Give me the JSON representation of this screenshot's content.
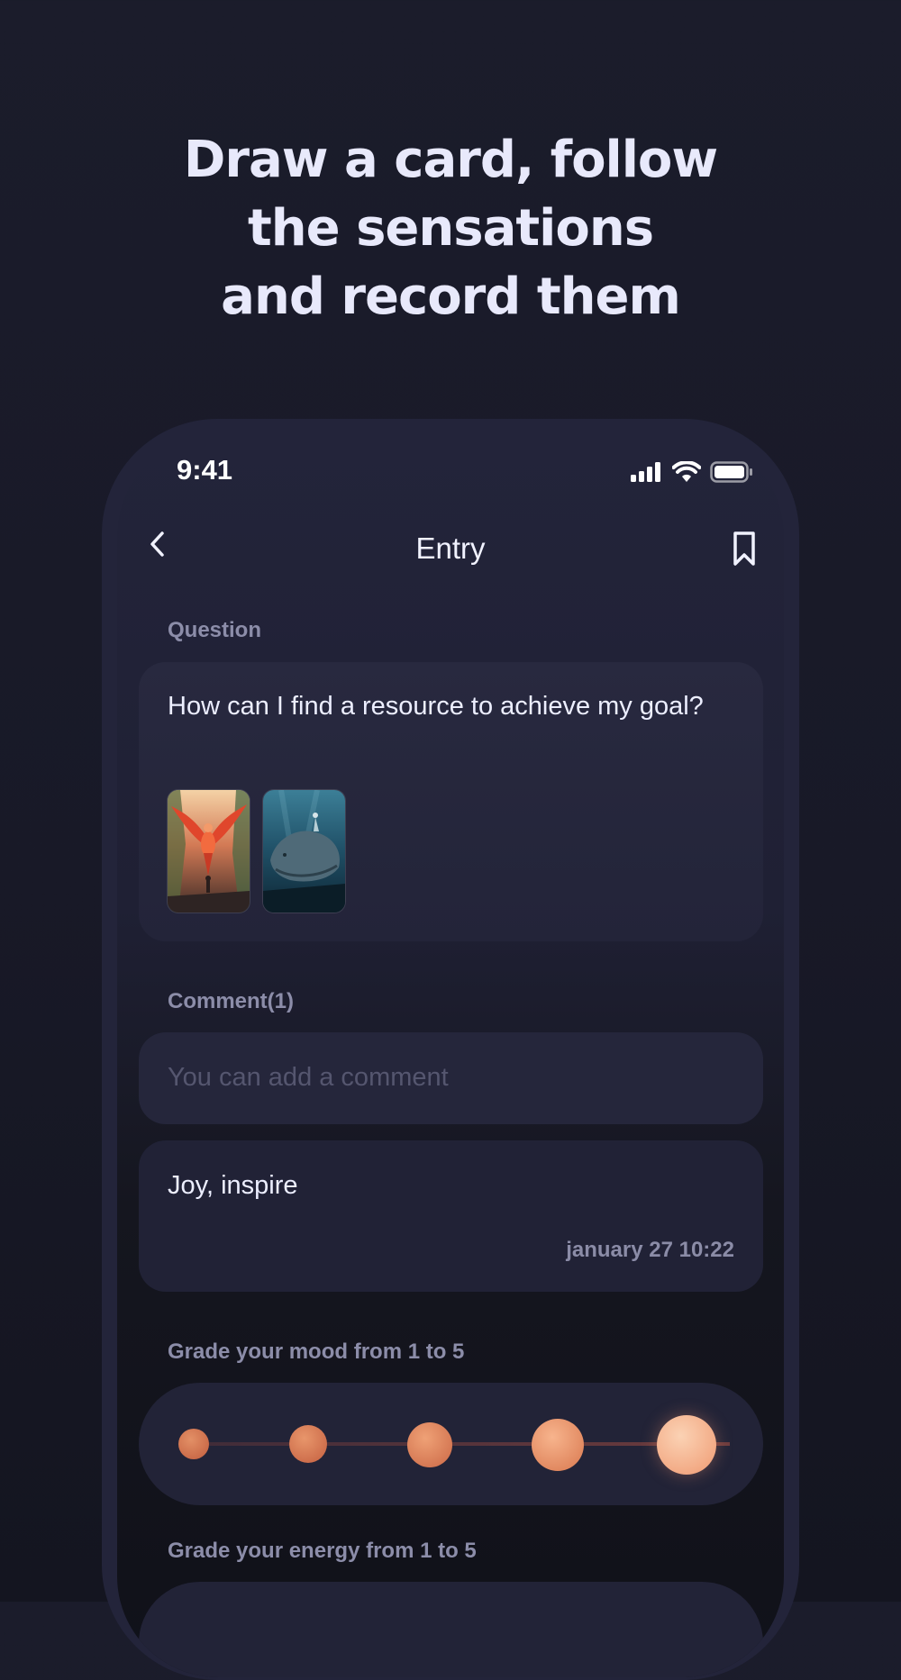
{
  "headline": {
    "line1": "Draw a card, follow",
    "line2": "the sensations",
    "line3": "and record them"
  },
  "status_bar": {
    "time": "9:41",
    "icons": [
      "signal-icon",
      "wifi-icon",
      "battery-icon"
    ]
  },
  "nav": {
    "title": "Entry",
    "back_icon": "chevron-left-icon",
    "bookmark_icon": "bookmark-icon"
  },
  "question": {
    "label": "Question",
    "text": "How can I find a resource to achieve my goal?",
    "cards": [
      "phoenix-card",
      "whale-card"
    ]
  },
  "comments": {
    "label": "Comment(1)",
    "input_placeholder": "You can add a comment",
    "items": [
      {
        "text": "Joy, inspire",
        "date": "january 27 10:22"
      }
    ]
  },
  "mood": {
    "label": "Grade your mood from 1 to 5",
    "options": [
      1,
      2,
      3,
      4,
      5
    ],
    "selected": 5
  },
  "energy": {
    "label": "Grade your energy from 1 to 5"
  },
  "colors": {
    "background": "#1a1b29",
    "card": "#27283e",
    "accent_moon": "#f2a27a",
    "text_primary": "#eceeff",
    "text_secondary": "#8c8da9"
  }
}
